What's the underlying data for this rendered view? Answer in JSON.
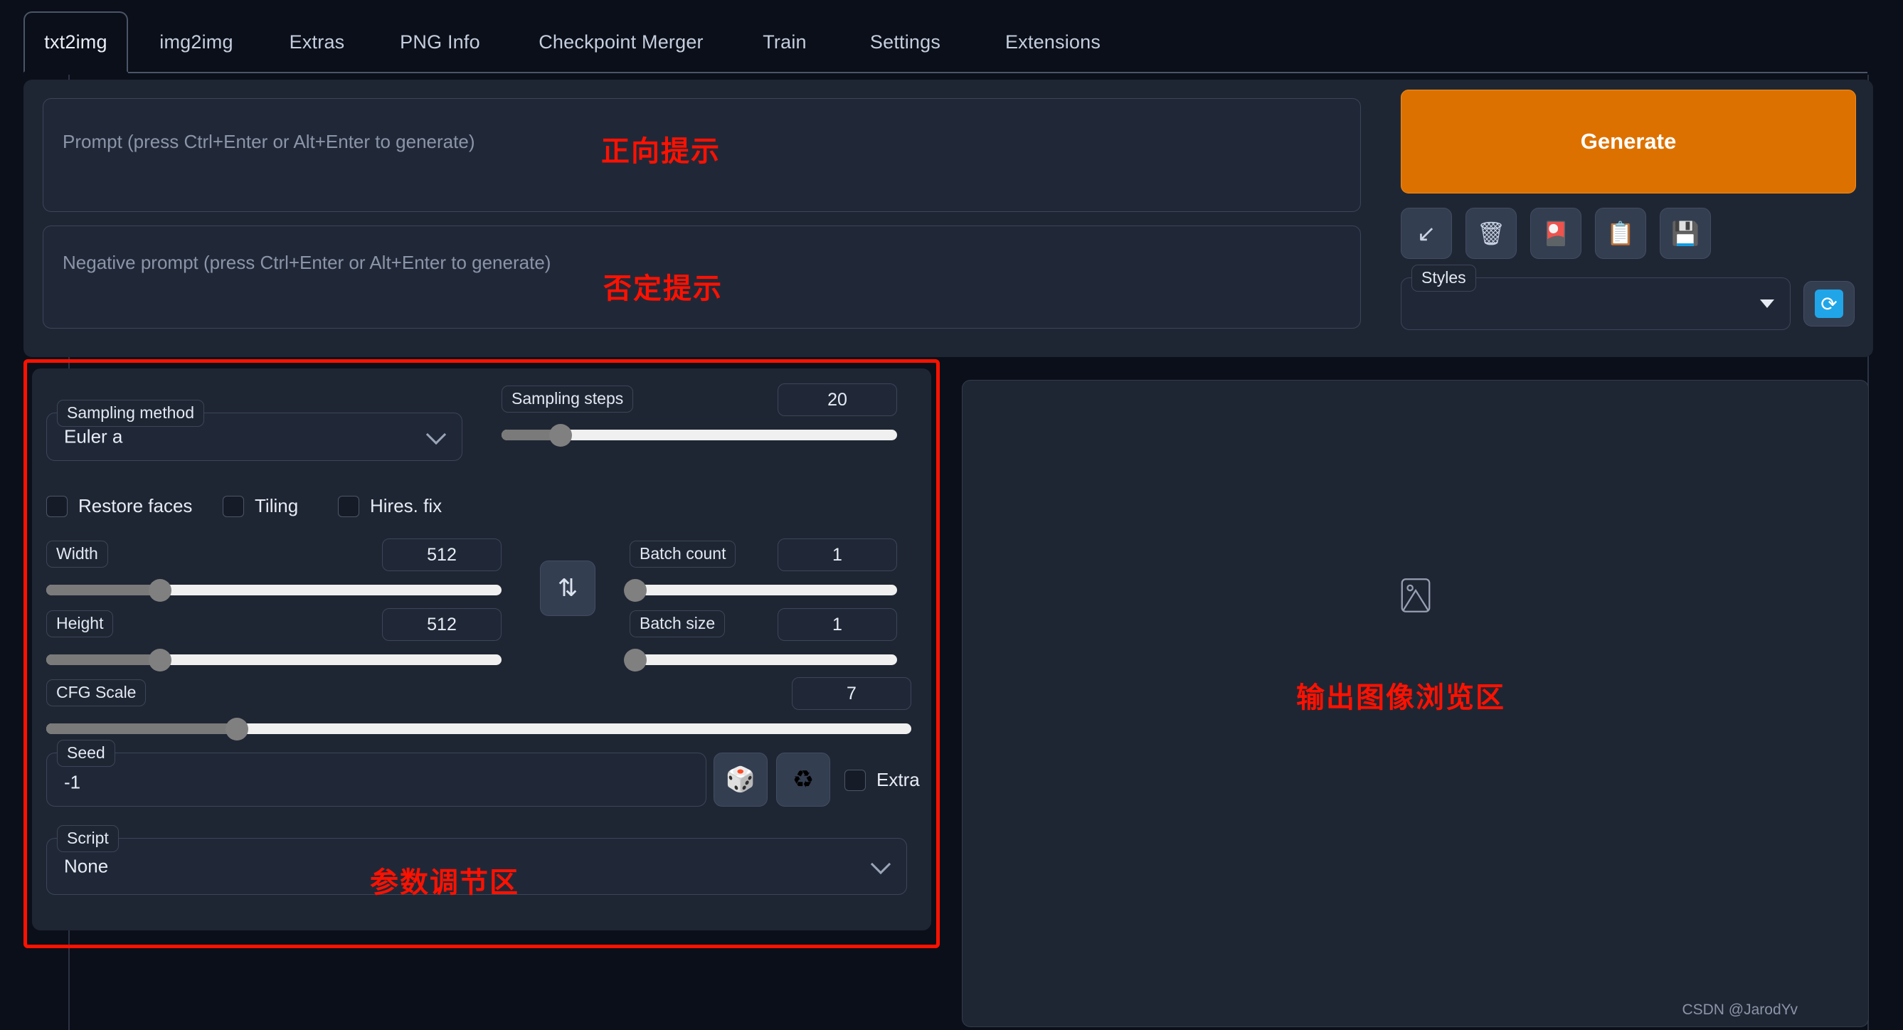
{
  "tabs": [
    {
      "label": "txt2img",
      "active": true
    },
    {
      "label": "img2img",
      "active": false
    },
    {
      "label": "Extras",
      "active": false
    },
    {
      "label": "PNG Info",
      "active": false
    },
    {
      "label": "Checkpoint Merger",
      "active": false
    },
    {
      "label": "Train",
      "active": false
    },
    {
      "label": "Settings",
      "active": false
    },
    {
      "label": "Extensions",
      "active": false
    }
  ],
  "prompt": {
    "positive_placeholder": "Prompt (press Ctrl+Enter or Alt+Enter to generate)",
    "positive_value": "",
    "negative_placeholder": "Negative prompt (press Ctrl+Enter or Alt+Enter to generate)",
    "negative_value": ""
  },
  "annotations": {
    "positive_prompt": "正向提示",
    "negative_prompt": "否定提示",
    "parameters": "参数调节区",
    "output": "输出图像浏览区",
    "color": "#ff1100"
  },
  "actions": {
    "generate_label": "Generate",
    "generate_color": "#dd7100",
    "icons": [
      {
        "name": "arrow-down-left-icon",
        "glyph": "↙"
      },
      {
        "name": "wastebasket-icon",
        "glyph": "🗑"
      },
      {
        "name": "pink-card-icon",
        "glyph": "🎴"
      },
      {
        "name": "clipboard-icon",
        "glyph": "📋"
      },
      {
        "name": "floppy-disk-icon",
        "glyph": "💾"
      }
    ]
  },
  "styles": {
    "label": "Styles",
    "value": "",
    "refresh_glyph": "⟳",
    "refresh_color": "#20a6e8"
  },
  "params": {
    "sampling_method": {
      "label": "Sampling method",
      "value": "Euler a"
    },
    "sampling_steps": {
      "label": "Sampling steps",
      "value": "20",
      "percent": 15
    },
    "checkboxes": [
      {
        "label": "Restore faces",
        "checked": false
      },
      {
        "label": "Tiling",
        "checked": false
      },
      {
        "label": "Hires. fix",
        "checked": false
      }
    ],
    "width": {
      "label": "Width",
      "value": "512",
      "percent": 25
    },
    "height": {
      "label": "Height",
      "value": "512",
      "percent": 25
    },
    "batch_count": {
      "label": "Batch count",
      "value": "1",
      "percent": 2
    },
    "batch_size": {
      "label": "Batch size",
      "value": "1",
      "percent": 2
    },
    "cfg_scale": {
      "label": "CFG Scale",
      "value": "7",
      "percent": 22
    },
    "swap_glyph": "⇅",
    "seed": {
      "label": "Seed",
      "value": "-1"
    },
    "seed_buttons": [
      {
        "name": "dice-icon",
        "glyph": "🎲"
      },
      {
        "name": "recycle-icon",
        "glyph": "♻"
      }
    ],
    "extra_checkbox": {
      "label": "Extra",
      "checked": false
    },
    "script": {
      "label": "Script",
      "value": "None"
    }
  },
  "output": {
    "placeholder_icon": "image-placeholder-icon"
  },
  "watermark": "CSDN @JarodYv"
}
